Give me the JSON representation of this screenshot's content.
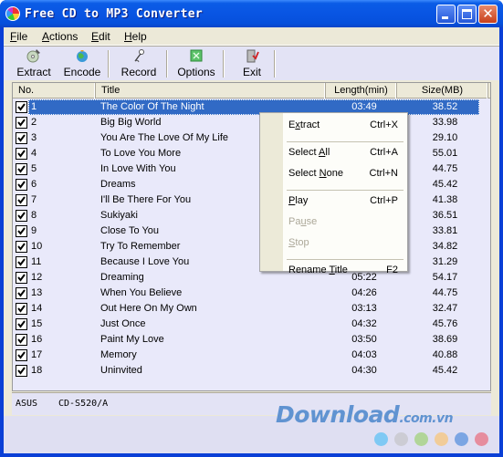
{
  "window": {
    "title": "Free CD to MP3 Converter",
    "controls": [
      "minimize",
      "maximize",
      "close"
    ]
  },
  "menubar": [
    {
      "label": "File",
      "accel": "F"
    },
    {
      "label": "Actions",
      "accel": "A"
    },
    {
      "label": "Edit",
      "accel": "E"
    },
    {
      "label": "Help",
      "accel": "H"
    }
  ],
  "toolbar": [
    {
      "label": "Extract",
      "icon": "cd-extract-icon"
    },
    {
      "label": "Encode",
      "icon": "globe-encode-icon"
    },
    {
      "label": "Record",
      "icon": "microphone-icon"
    },
    {
      "label": "Options",
      "icon": "options-icon"
    },
    {
      "label": "Exit",
      "icon": "exit-door-icon"
    }
  ],
  "table": {
    "columns": [
      "No.",
      "Title",
      "Length(min)",
      "Size(MB)"
    ],
    "selected_row": 0,
    "rows": [
      {
        "checked": true,
        "no": "1",
        "title": "The Color Of The Night",
        "length": "03:49",
        "size": "38.52"
      },
      {
        "checked": true,
        "no": "2",
        "title": "Big Big World",
        "length": "",
        "size": "33.98"
      },
      {
        "checked": true,
        "no": "3",
        "title": "You Are The Love Of My Life",
        "length": "",
        "size": "29.10"
      },
      {
        "checked": true,
        "no": "4",
        "title": "To Love You More",
        "length": "",
        "size": "55.01"
      },
      {
        "checked": true,
        "no": "5",
        "title": "In Love With You",
        "length": "",
        "size": "44.75"
      },
      {
        "checked": true,
        "no": "6",
        "title": "Dreams",
        "length": "",
        "size": "45.42"
      },
      {
        "checked": true,
        "no": "7",
        "title": "I'll Be There For You",
        "length": "",
        "size": "41.38"
      },
      {
        "checked": true,
        "no": "8",
        "title": "Sukiyaki",
        "length": "",
        "size": "36.51"
      },
      {
        "checked": true,
        "no": "9",
        "title": "Close To You",
        "length": "",
        "size": "33.81"
      },
      {
        "checked": true,
        "no": "10",
        "title": "Try To Remember",
        "length": "",
        "size": "34.82"
      },
      {
        "checked": true,
        "no": "11",
        "title": "Because I Love You",
        "length": "",
        "size": "31.29"
      },
      {
        "checked": true,
        "no": "12",
        "title": "Dreaming",
        "length": "05:22",
        "size": "54.17"
      },
      {
        "checked": true,
        "no": "13",
        "title": "When You Believe",
        "length": "04:26",
        "size": "44.75"
      },
      {
        "checked": true,
        "no": "14",
        "title": "Out Here On My Own",
        "length": "03:13",
        "size": "32.47"
      },
      {
        "checked": true,
        "no": "15",
        "title": "Just Once",
        "length": "04:32",
        "size": "45.76"
      },
      {
        "checked": true,
        "no": "16",
        "title": "Paint My Love",
        "length": "03:50",
        "size": "38.69"
      },
      {
        "checked": true,
        "no": "17",
        "title": "Memory",
        "length": "04:03",
        "size": "40.88"
      },
      {
        "checked": true,
        "no": "18",
        "title": "Uninvited",
        "length": "04:30",
        "size": "45.42"
      }
    ]
  },
  "context_menu": {
    "items": [
      {
        "label": "Extract",
        "accel": "x",
        "shortcut": "Ctrl+X",
        "enabled": true
      },
      {
        "separator": true
      },
      {
        "label": "Select All",
        "accel": "A",
        "shortcut": "Ctrl+A",
        "enabled": true
      },
      {
        "label": "Select None",
        "accel": "N",
        "shortcut": "Ctrl+N",
        "enabled": true
      },
      {
        "separator": true
      },
      {
        "label": "Play",
        "accel": "P",
        "shortcut": "Ctrl+P",
        "enabled": true
      },
      {
        "label": "Pause",
        "accel": "u",
        "shortcut": "",
        "enabled": false
      },
      {
        "label": "Stop",
        "accel": "S",
        "shortcut": "",
        "enabled": false
      },
      {
        "separator": true
      },
      {
        "label": "Rename Title",
        "accel": "T",
        "shortcut": "F2",
        "enabled": true
      }
    ]
  },
  "status": {
    "drive_vendor": "ASUS",
    "drive_model": "CD-S520/A"
  },
  "watermark": {
    "text": "Download",
    "suffix": ".com.vn",
    "dot_colors": [
      "#6ec6f5",
      "#c9c9cf",
      "#a9d48a",
      "#f5c98a",
      "#6a9be0",
      "#e87f8f"
    ]
  },
  "colors": {
    "titlebar": "#0955e3",
    "selection": "#316ac5",
    "list_bg": "#e9e9fa",
    "menu_bg": "#ece9d8"
  }
}
